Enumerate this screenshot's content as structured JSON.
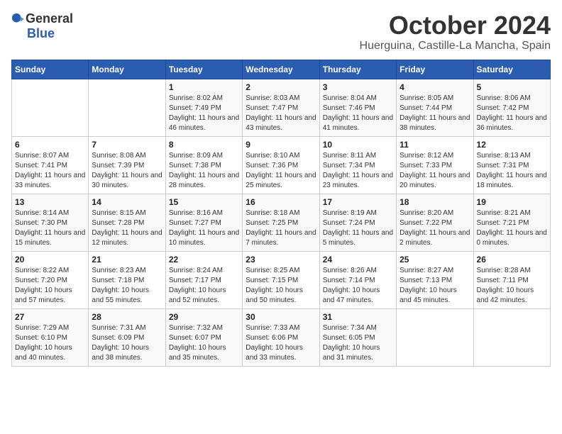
{
  "logo": {
    "general": "General",
    "blue": "Blue"
  },
  "calendar": {
    "title": "October 2024",
    "subtitle": "Huerguina, Castille-La Mancha, Spain"
  },
  "headers": [
    "Sunday",
    "Monday",
    "Tuesday",
    "Wednesday",
    "Thursday",
    "Friday",
    "Saturday"
  ],
  "weeks": [
    [
      {
        "day": "",
        "info": ""
      },
      {
        "day": "",
        "info": ""
      },
      {
        "day": "1",
        "info": "Sunrise: 8:02 AM\nSunset: 7:49 PM\nDaylight: 11 hours and 46 minutes."
      },
      {
        "day": "2",
        "info": "Sunrise: 8:03 AM\nSunset: 7:47 PM\nDaylight: 11 hours and 43 minutes."
      },
      {
        "day": "3",
        "info": "Sunrise: 8:04 AM\nSunset: 7:46 PM\nDaylight: 11 hours and 41 minutes."
      },
      {
        "day": "4",
        "info": "Sunrise: 8:05 AM\nSunset: 7:44 PM\nDaylight: 11 hours and 38 minutes."
      },
      {
        "day": "5",
        "info": "Sunrise: 8:06 AM\nSunset: 7:42 PM\nDaylight: 11 hours and 36 minutes."
      }
    ],
    [
      {
        "day": "6",
        "info": "Sunrise: 8:07 AM\nSunset: 7:41 PM\nDaylight: 11 hours and 33 minutes."
      },
      {
        "day": "7",
        "info": "Sunrise: 8:08 AM\nSunset: 7:39 PM\nDaylight: 11 hours and 30 minutes."
      },
      {
        "day": "8",
        "info": "Sunrise: 8:09 AM\nSunset: 7:38 PM\nDaylight: 11 hours and 28 minutes."
      },
      {
        "day": "9",
        "info": "Sunrise: 8:10 AM\nSunset: 7:36 PM\nDaylight: 11 hours and 25 minutes."
      },
      {
        "day": "10",
        "info": "Sunrise: 8:11 AM\nSunset: 7:34 PM\nDaylight: 11 hours and 23 minutes."
      },
      {
        "day": "11",
        "info": "Sunrise: 8:12 AM\nSunset: 7:33 PM\nDaylight: 11 hours and 20 minutes."
      },
      {
        "day": "12",
        "info": "Sunrise: 8:13 AM\nSunset: 7:31 PM\nDaylight: 11 hours and 18 minutes."
      }
    ],
    [
      {
        "day": "13",
        "info": "Sunrise: 8:14 AM\nSunset: 7:30 PM\nDaylight: 11 hours and 15 minutes."
      },
      {
        "day": "14",
        "info": "Sunrise: 8:15 AM\nSunset: 7:28 PM\nDaylight: 11 hours and 12 minutes."
      },
      {
        "day": "15",
        "info": "Sunrise: 8:16 AM\nSunset: 7:27 PM\nDaylight: 11 hours and 10 minutes."
      },
      {
        "day": "16",
        "info": "Sunrise: 8:18 AM\nSunset: 7:25 PM\nDaylight: 11 hours and 7 minutes."
      },
      {
        "day": "17",
        "info": "Sunrise: 8:19 AM\nSunset: 7:24 PM\nDaylight: 11 hours and 5 minutes."
      },
      {
        "day": "18",
        "info": "Sunrise: 8:20 AM\nSunset: 7:22 PM\nDaylight: 11 hours and 2 minutes."
      },
      {
        "day": "19",
        "info": "Sunrise: 8:21 AM\nSunset: 7:21 PM\nDaylight: 11 hours and 0 minutes."
      }
    ],
    [
      {
        "day": "20",
        "info": "Sunrise: 8:22 AM\nSunset: 7:20 PM\nDaylight: 10 hours and 57 minutes."
      },
      {
        "day": "21",
        "info": "Sunrise: 8:23 AM\nSunset: 7:18 PM\nDaylight: 10 hours and 55 minutes."
      },
      {
        "day": "22",
        "info": "Sunrise: 8:24 AM\nSunset: 7:17 PM\nDaylight: 10 hours and 52 minutes."
      },
      {
        "day": "23",
        "info": "Sunrise: 8:25 AM\nSunset: 7:15 PM\nDaylight: 10 hours and 50 minutes."
      },
      {
        "day": "24",
        "info": "Sunrise: 8:26 AM\nSunset: 7:14 PM\nDaylight: 10 hours and 47 minutes."
      },
      {
        "day": "25",
        "info": "Sunrise: 8:27 AM\nSunset: 7:13 PM\nDaylight: 10 hours and 45 minutes."
      },
      {
        "day": "26",
        "info": "Sunrise: 8:28 AM\nSunset: 7:11 PM\nDaylight: 10 hours and 42 minutes."
      }
    ],
    [
      {
        "day": "27",
        "info": "Sunrise: 7:29 AM\nSunset: 6:10 PM\nDaylight: 10 hours and 40 minutes."
      },
      {
        "day": "28",
        "info": "Sunrise: 7:31 AM\nSunset: 6:09 PM\nDaylight: 10 hours and 38 minutes."
      },
      {
        "day": "29",
        "info": "Sunrise: 7:32 AM\nSunset: 6:07 PM\nDaylight: 10 hours and 35 minutes."
      },
      {
        "day": "30",
        "info": "Sunrise: 7:33 AM\nSunset: 6:06 PM\nDaylight: 10 hours and 33 minutes."
      },
      {
        "day": "31",
        "info": "Sunrise: 7:34 AM\nSunset: 6:05 PM\nDaylight: 10 hours and 31 minutes."
      },
      {
        "day": "",
        "info": ""
      },
      {
        "day": "",
        "info": ""
      }
    ]
  ]
}
